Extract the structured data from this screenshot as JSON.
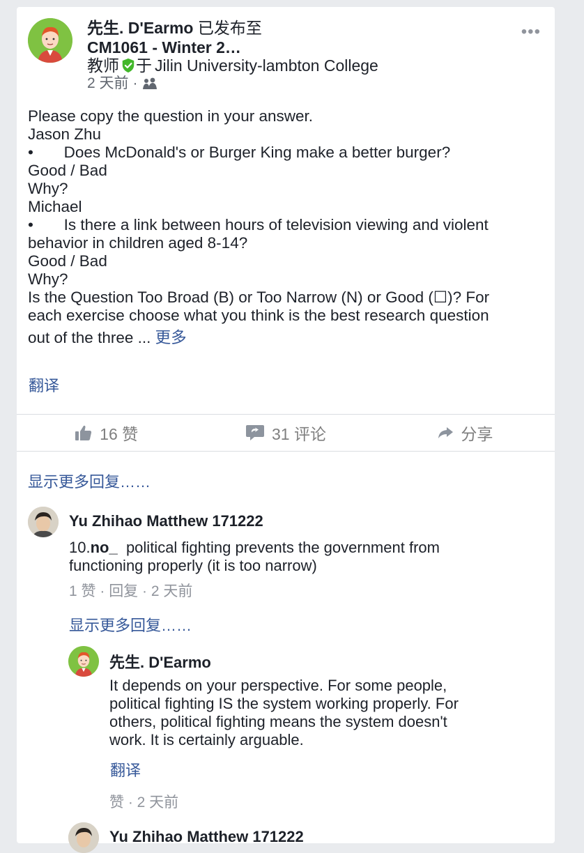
{
  "post": {
    "author": "先生. D'Earmo",
    "posted_to": "已发布至",
    "group": "CM1061 - Winter 2…",
    "role": "教师",
    "org_prefix": "于",
    "org": "Jilin University-lambton College",
    "time": "2 天前",
    "dot": "·",
    "more": "•••",
    "body_lines": [
      "Please copy the question in your answer.",
      "Jason Zhu",
      "•       Does McDonald's or Burger King make a better burger?",
      "Good / Bad",
      "Why?",
      "Michael",
      "•       Is there a link between hours of television viewing and violent",
      "behavior in children aged 8-14?",
      "Good / Bad",
      "Why?",
      "Is the Question Too Broad (B) or Too Narrow (N) or Good (☐)? For",
      "each exercise choose what you think is the best research question"
    ],
    "last_line": "out of the three ... ",
    "see_more": "更多",
    "translate": "翻译"
  },
  "actions": {
    "like": "16 赞",
    "comment": "31 评论",
    "share": "分享"
  },
  "comments": {
    "show_more": "显示更多回复……",
    "c1": {
      "name": "Yu Zhihao Matthew 171222",
      "text_prefix": "10.",
      "text_bold": "no_",
      "text_rest": "  political fighting prevents the government from",
      "text_line2": "functioning properly (it is too narrow)",
      "likes": "1 赞",
      "reply": "回复",
      "time": "2 天前"
    },
    "show_more_replies": "显示更多回复……",
    "reply1": {
      "name": "先生. D'Earmo",
      "lines": [
        "It depends on your perspective. For some people,",
        "political fighting IS the system working properly. For",
        "others, political fighting means the system doesn't",
        "work. It is certainly arguable."
      ],
      "translate": "翻译",
      "like": "赞",
      "time": "2 天前"
    },
    "c3_name": "Yu Zhihao Matthew 171222"
  },
  "colors": {
    "link": "#365899",
    "avatar_bg": "#7fc242",
    "verified": "#42b72a"
  }
}
